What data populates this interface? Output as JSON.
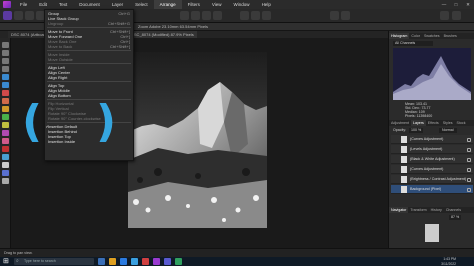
{
  "menubar": {
    "items": [
      "File",
      "Edit",
      "Text",
      "Document",
      "Layer",
      "Select",
      "Arrange",
      "Filters",
      "View",
      "Window",
      "Help"
    ],
    "active_index": 6
  },
  "window_controls": {
    "minimize": "—",
    "maximize": "□",
    "close": "✕"
  },
  "contextbar": {
    "zoom_text": "Zoom Adobe 23.10mm 63.54mm  Pixels"
  },
  "doctabs": [
    "DSC_8074 (Modified) 87.9%  Pixels"
  ],
  "left_tabs": [
    "DSC 8074 (Artboard)"
  ],
  "arrange_menu": {
    "rows": [
      {
        "label": "Group",
        "shortcut": "Ctrl+G",
        "enabled": true
      },
      {
        "label": "Live Stack Group",
        "shortcut": "",
        "enabled": true
      },
      {
        "label": "Ungroup",
        "shortcut": "Ctrl+Shift+G",
        "enabled": false
      },
      {
        "sep": true
      },
      {
        "label": "Move to Front",
        "shortcut": "Ctrl+Shift+]",
        "enabled": true
      },
      {
        "label": "Move Forward One",
        "shortcut": "Ctrl+]",
        "enabled": true
      },
      {
        "label": "Move Back One",
        "shortcut": "Ctrl+[",
        "enabled": false
      },
      {
        "label": "Move to Back",
        "shortcut": "Ctrl+Shift+[",
        "enabled": false
      },
      {
        "sep": true
      },
      {
        "label": "Move Inside",
        "shortcut": "",
        "enabled": false
      },
      {
        "label": "Move Outside",
        "shortcut": "",
        "enabled": false
      },
      {
        "sep": true
      },
      {
        "label": "Align Left",
        "shortcut": "",
        "enabled": true
      },
      {
        "label": "Align Center",
        "shortcut": "",
        "enabled": true
      },
      {
        "label": "Align Right",
        "shortcut": "",
        "enabled": true
      },
      {
        "sep": true
      },
      {
        "label": "Align Top",
        "shortcut": "",
        "enabled": true
      },
      {
        "label": "Align Middle",
        "shortcut": "",
        "enabled": true
      },
      {
        "label": "Align Bottom",
        "shortcut": "",
        "enabled": true
      },
      {
        "sep": true
      },
      {
        "label": "Flip Horizontal",
        "shortcut": "",
        "enabled": false
      },
      {
        "label": "Flip Vertical",
        "shortcut": "",
        "enabled": false
      },
      {
        "label": "Rotate 90° Clockwise",
        "shortcut": "",
        "enabled": false
      },
      {
        "label": "Rotate 90° Counter-clockwise",
        "shortcut": "",
        "enabled": false
      },
      {
        "sep": true
      },
      {
        "label": "Insertion Default",
        "shortcut": "",
        "enabled": true,
        "checked": true
      },
      {
        "label": "Insertion Behind",
        "shortcut": "",
        "enabled": true
      },
      {
        "label": "Insertion Top",
        "shortcut": "",
        "enabled": true
      },
      {
        "label": "Insertion Inside",
        "shortcut": "",
        "enabled": true
      }
    ]
  },
  "histogram_panel": {
    "tabs": [
      "Histogram",
      "Color",
      "Swatches",
      "Brushes"
    ],
    "channel": "All Channels",
    "stats": [
      "Mean: 103.41",
      "Std. Dev.: 73.77",
      "Median: 109",
      "Pixels: 11398400"
    ]
  },
  "layers_panel": {
    "tabs": [
      "Adjustment",
      "Layers",
      "Effects",
      "Styles",
      "Stock"
    ],
    "opacity_label": "Opacity:",
    "opacity_value": "100 %",
    "blend_mode": "Normal",
    "layers": [
      {
        "name": "(Curves Adjustment)",
        "selected": false
      },
      {
        "name": "(Levels Adjustment)",
        "selected": false
      },
      {
        "name": "(Black & White Adjustment)",
        "selected": false
      },
      {
        "name": "(Curves Adjustment)",
        "selected": false
      },
      {
        "name": "(Brightness / Contrast Adjustment)",
        "selected": false
      },
      {
        "name": "Background (Pixel)",
        "selected": true
      }
    ]
  },
  "navigator_panel": {
    "tabs": [
      "Navigator",
      "Transform",
      "History",
      "Channels"
    ],
    "zoom": "87 %"
  },
  "statusbar": {
    "text": "Drag to pan view."
  },
  "taskbar": {
    "search_placeholder": "Type here to search",
    "time": "1:43 PM",
    "date": "3/11/2022"
  },
  "colors": {
    "accent": "#35a6e0",
    "selection": "#2f4e79",
    "app_logo": "#c63fd0"
  }
}
